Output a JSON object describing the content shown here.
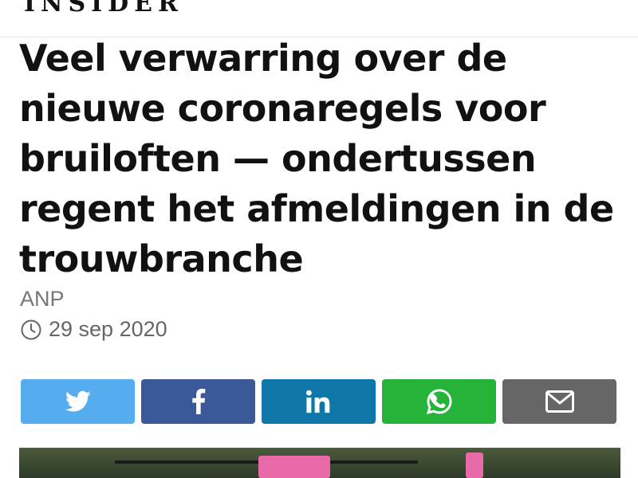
{
  "header": {
    "brand": "INSIDER"
  },
  "article": {
    "title": "Veel verwarring over de nieuwe coronaregels voor bruiloften — ondertussen regent het afmeldingen in de trouwbranche",
    "author": "ANP",
    "date": "29 sep 2020",
    "date_icon": "clock-icon"
  },
  "share": {
    "buttons": [
      {
        "network": "twitter",
        "icon": "twitter-icon",
        "color": "#55acee"
      },
      {
        "network": "facebook",
        "icon": "facebook-icon",
        "color": "#3b5998"
      },
      {
        "network": "linkedin",
        "icon": "linkedin-icon",
        "color": "#0e76a8"
      },
      {
        "network": "whatsapp",
        "icon": "whatsapp-icon",
        "color": "#25b33a"
      },
      {
        "network": "email",
        "icon": "email-icon",
        "color": "#666666"
      }
    ]
  },
  "hero_image": {
    "icon": "article-photo"
  }
}
